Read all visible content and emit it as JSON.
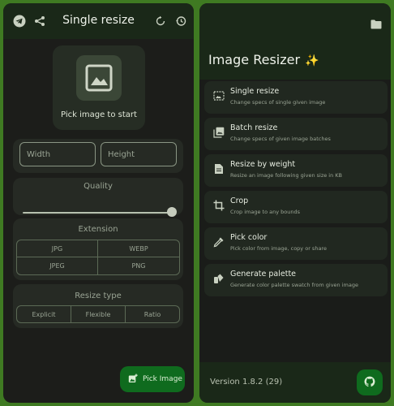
{
  "left": {
    "title": "Single resize",
    "pick_prompt": "Pick image to start",
    "width_placeholder": "Width",
    "height_placeholder": "Height",
    "quality_label": "Quality",
    "quality_value": 1.0,
    "extension_label": "Extension",
    "extensions": [
      "JPG",
      "WEBP",
      "JPEG",
      "PNG"
    ],
    "resize_type_label": "Resize type",
    "resize_types": [
      "Explicit",
      "Flexible",
      "Ratio"
    ],
    "fab_label": "Pick Image"
  },
  "right": {
    "app_title": "Image Resizer",
    "sparkle": "✨",
    "menu": [
      {
        "title": "Single resize",
        "subtitle": "Change specs of single given image"
      },
      {
        "title": "Batch resize",
        "subtitle": "Change specs of given image batches"
      },
      {
        "title": "Resize by weight",
        "subtitle": "Resize an image following given size in KB"
      },
      {
        "title": "Crop",
        "subtitle": "Crop image to any bounds"
      },
      {
        "title": "Pick color",
        "subtitle": "Pick color from image, copy or share"
      },
      {
        "title": "Generate palette",
        "subtitle": "Generate color palette swatch from given image"
      }
    ],
    "version": "Version 1.8.2 (29)"
  },
  "colors": {
    "accent": "#0f6b1e",
    "frame": "#3f7a22",
    "surface": "#262a24"
  }
}
